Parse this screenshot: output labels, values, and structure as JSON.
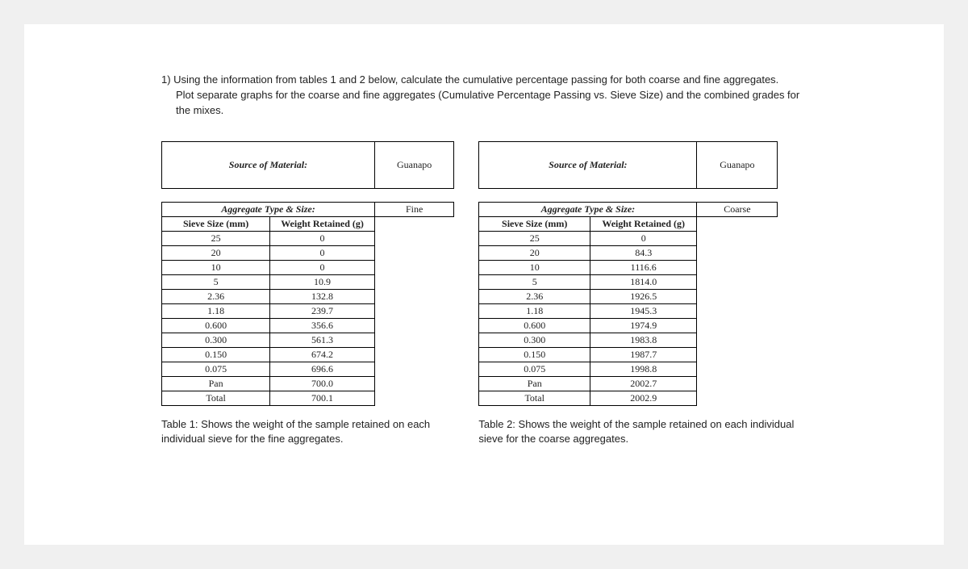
{
  "question": {
    "prefix": "1) Using the information from tables 1 and 2 below, calculate the cumulative percentage passing for both coarse and fine aggregates.",
    "line2": "Plot separate graphs for the coarse and fine aggregates (Cumulative Percentage Passing vs. Sieve Size) and the combined grades for the mixes."
  },
  "labels": {
    "source": "Source of Material:",
    "aggType": "Aggregate Type & Size:",
    "sieve": "Sieve Size (mm)",
    "wtRetained": "Weight Retained (g)",
    "wtRetainedShort": "Weight Retained (g)"
  },
  "table1": {
    "source": "Guanapo",
    "aggType": "Fine",
    "rows": [
      {
        "s": "25",
        "w": "0"
      },
      {
        "s": "20",
        "w": "0"
      },
      {
        "s": "10",
        "w": "0"
      },
      {
        "s": "5",
        "w": "10.9"
      },
      {
        "s": "2.36",
        "w": "132.8"
      },
      {
        "s": "1.18",
        "w": "239.7"
      },
      {
        "s": "0.600",
        "w": "356.6"
      },
      {
        "s": "0.300",
        "w": "561.3"
      },
      {
        "s": "0.150",
        "w": "674.2"
      },
      {
        "s": "0.075",
        "w": "696.6"
      },
      {
        "s": "Pan",
        "w": "700.0"
      },
      {
        "s": "Total",
        "w": "700.1"
      }
    ],
    "caption": "Table 1: Shows the weight of the sample retained on each individual sieve for the fine aggregates."
  },
  "table2": {
    "source": "Guanapo",
    "aggType": "Coarse",
    "rows": [
      {
        "s": "25",
        "w": "0"
      },
      {
        "s": "20",
        "w": "84.3"
      },
      {
        "s": "10",
        "w": "1116.6"
      },
      {
        "s": "5",
        "w": "1814.0"
      },
      {
        "s": "2.36",
        "w": "1926.5"
      },
      {
        "s": "1.18",
        "w": "1945.3"
      },
      {
        "s": "0.600",
        "w": "1974.9"
      },
      {
        "s": "0.300",
        "w": "1983.8"
      },
      {
        "s": "0.150",
        "w": "1987.7"
      },
      {
        "s": "0.075",
        "w": "1998.8"
      },
      {
        "s": "Pan",
        "w": "2002.7"
      },
      {
        "s": "Total",
        "w": "2002.9"
      }
    ],
    "caption": "Table 2: Shows the weight of the sample retained on each individual sieve for the coarse aggregates."
  }
}
